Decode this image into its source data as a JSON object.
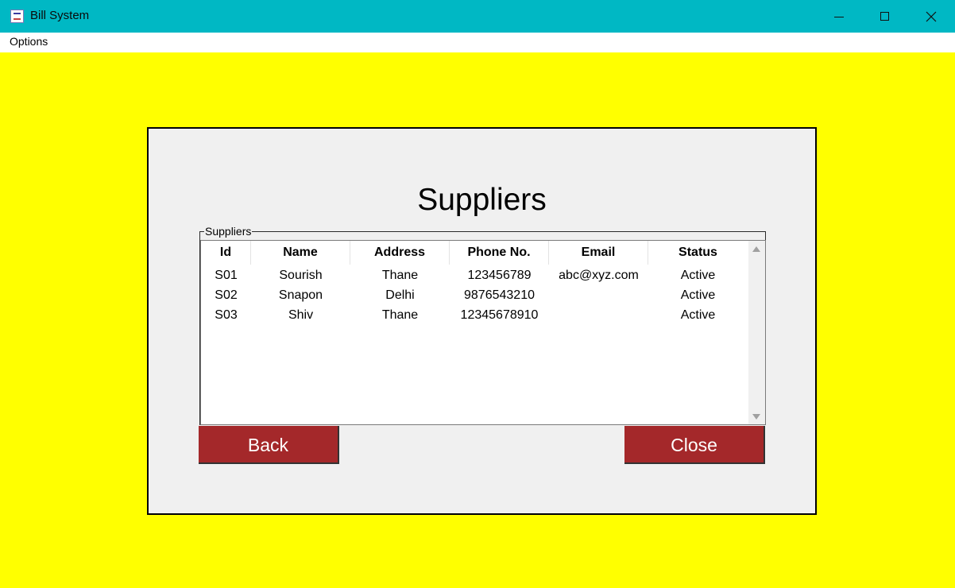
{
  "window": {
    "title": "Bill System"
  },
  "menu": {
    "options_label": "Options"
  },
  "page": {
    "heading": "Suppliers",
    "group_label": "Suppliers"
  },
  "table": {
    "columns": [
      "Id",
      "Name",
      "Address",
      "Phone No.",
      "Email",
      "Status"
    ],
    "rows": [
      [
        "S01",
        "Sourish",
        "Thane",
        "123456789",
        "abc@xyz.com",
        "Active"
      ],
      [
        "S02",
        "Snapon",
        "Delhi",
        "9876543210",
        "",
        "Active"
      ],
      [
        "S03",
        "Shiv",
        "Thane",
        "12345678910",
        "",
        "Active"
      ]
    ]
  },
  "buttons": {
    "back_label": "Back",
    "close_label": "Close"
  },
  "colors": {
    "titlebar": "#00b8c4",
    "background": "#ffff00",
    "button": "#a4282a"
  },
  "icons": {
    "app": "bill-system-app-icon",
    "minimize": "minimize-icon",
    "maximize": "maximize-icon",
    "close": "close-icon"
  }
}
